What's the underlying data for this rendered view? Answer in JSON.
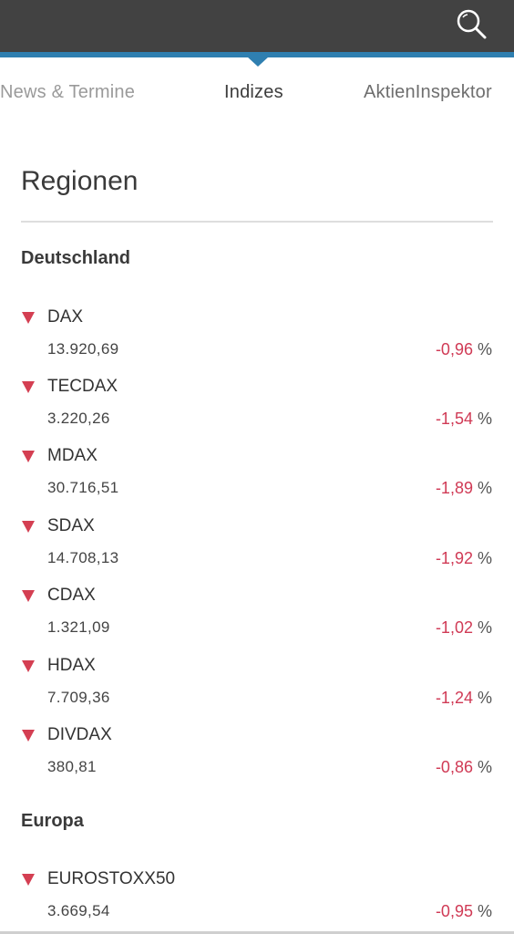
{
  "header": {
    "search_icon": "search-icon",
    "accent_color": "#2f7fb0",
    "bar_color": "#424242"
  },
  "tabs": [
    {
      "label": "News & Termine"
    },
    {
      "label": "Indizes"
    },
    {
      "label": "AktienInspektor"
    }
  ],
  "regions": {
    "title": "Regionen",
    "groups": [
      {
        "heading": "Deutschland",
        "indices": [
          {
            "name": "DAX",
            "value": "13.920,69",
            "change": "-0,96",
            "unit": "%"
          },
          {
            "name": "TECDAX",
            "value": "3.220,26",
            "change": "-1,54",
            "unit": "%"
          },
          {
            "name": "MDAX",
            "value": "30.716,51",
            "change": "-1,89",
            "unit": "%"
          },
          {
            "name": "SDAX",
            "value": "14.708,13",
            "change": "-1,92",
            "unit": "%"
          },
          {
            "name": "CDAX",
            "value": "1.321,09",
            "change": "-1,02",
            "unit": "%"
          },
          {
            "name": "HDAX",
            "value": "7.709,36",
            "change": "-1,24",
            "unit": "%"
          },
          {
            "name": "DIVDAX",
            "value": "380,81",
            "change": "-0,86",
            "unit": "%"
          }
        ]
      },
      {
        "heading": "Europa",
        "indices": [
          {
            "name": "EUROSTOXX50",
            "value": "3.669,54",
            "change": "-0,95",
            "unit": "%"
          }
        ]
      }
    ]
  },
  "colors": {
    "negative": "#d03a55",
    "down_arrow": "#d43f52"
  }
}
